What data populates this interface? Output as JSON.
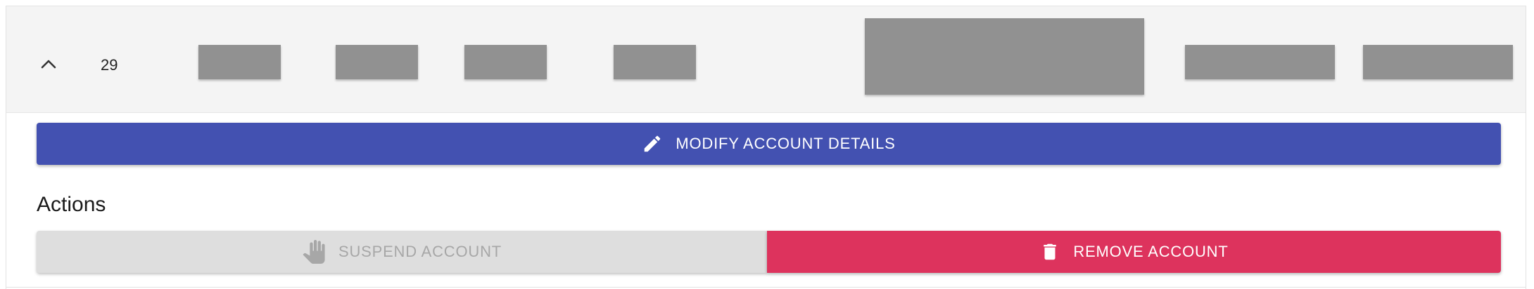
{
  "row": {
    "id": "29",
    "expanded": true,
    "toggle_icon": "chevron-up-icon"
  },
  "buttons": {
    "modify": {
      "label": "MODIFY ACCOUNT DETAILS",
      "icon": "pencil-icon",
      "color": "#4351b1"
    },
    "suspend": {
      "label": "SUSPEND ACCOUNT",
      "icon": "hand-icon",
      "disabled": true,
      "color": "#dedede"
    },
    "remove": {
      "label": "REMOVE ACCOUNT",
      "icon": "trash-icon",
      "color": "#dd335d"
    }
  },
  "actions_heading": "Actions",
  "colors": {
    "row_background": "#f4f4f4",
    "redaction": "#919191"
  }
}
